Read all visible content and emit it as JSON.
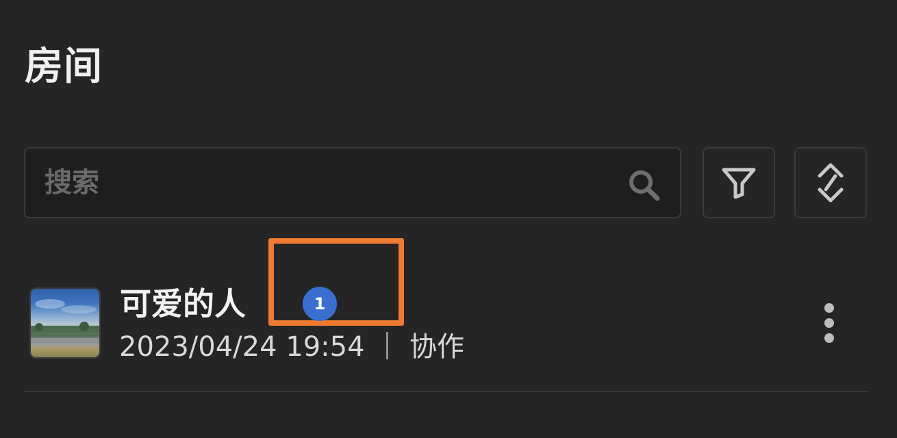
{
  "header": {
    "title": "房间"
  },
  "search": {
    "placeholder": "搜索",
    "value": "",
    "icon": "search-icon"
  },
  "toolbar": {
    "filter_icon": "filter-icon",
    "sort_icon": "sort-icon"
  },
  "rooms": [
    {
      "name": "可爱的人",
      "meta": "2023/04/24 19:54 ｜ 协作",
      "avatar": "landscape-thumbnail",
      "menu_icon": "more-vertical-icon"
    }
  ],
  "annotation": {
    "marker_label": "1",
    "box_color": "#ef7a32",
    "marker_color": "#3a6fcf"
  },
  "colors": {
    "background": "#252525",
    "border": "#3a3a3a",
    "text": "#f0f0f0"
  }
}
